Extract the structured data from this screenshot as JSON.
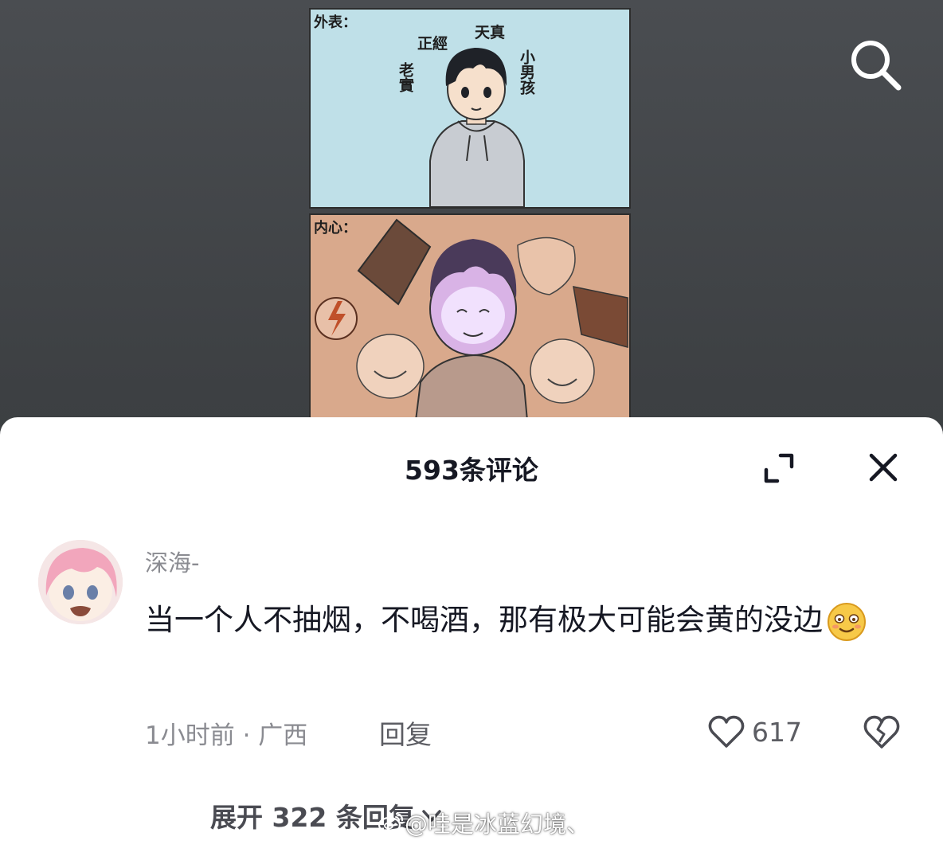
{
  "comic": {
    "top_panel_label": "外表：",
    "bottom_panel_label": "内心：",
    "tags": [
      "老實",
      "正經",
      "天真",
      "小男孩"
    ]
  },
  "search": {
    "icon": "search-icon"
  },
  "comments_panel": {
    "title": "593条评论",
    "expand_icon": "expand-icon",
    "close_icon": "close-icon",
    "comment": {
      "username": "深海-",
      "text": "当一个人不抽烟，不喝酒，那有极大可能会黄的没边",
      "emoji": "smirk-emoji",
      "time_location": "1小时前 · 广西",
      "reply_label": "回复",
      "like_count": "617",
      "expand_replies": "展开 322 条回复"
    }
  },
  "watermark": "@哇是冰蓝幻境、",
  "colors": {
    "background": "#3a3d40",
    "sheet": "#ffffff",
    "primary_text": "#161823",
    "secondary_text": "#8a8b91",
    "top_panel": "#bfe0e8",
    "bottom_panel": "#d9a98c"
  }
}
